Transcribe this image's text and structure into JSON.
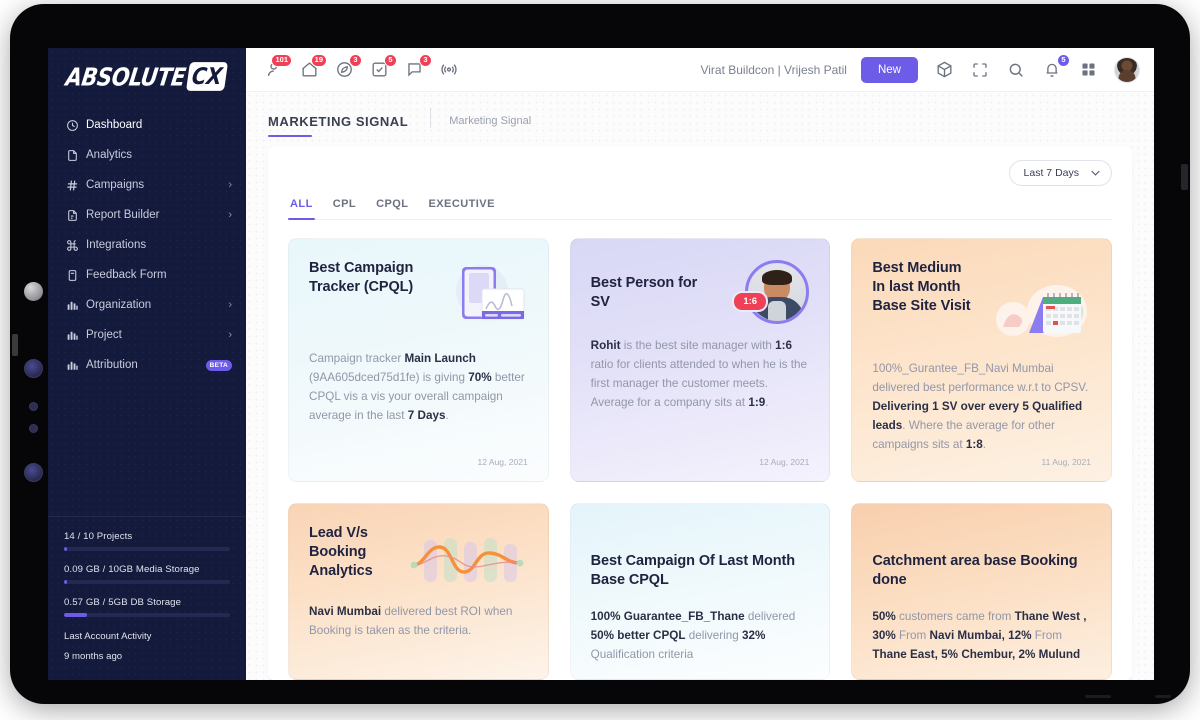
{
  "brand": {
    "name": "ABSOLUTE",
    "suffix": "CX",
    "accent": "#6c5ce7",
    "sidebar_bg": "#141a3c"
  },
  "sidebar": {
    "items": [
      {
        "label": "Dashboard",
        "icon": "clock-icon",
        "chevron": "",
        "badge": ""
      },
      {
        "label": "Analytics",
        "icon": "document-icon",
        "chevron": "",
        "badge": ""
      },
      {
        "label": "Campaigns",
        "icon": "hash-icon",
        "chevron": "›",
        "badge": ""
      },
      {
        "label": "Report Builder",
        "icon": "report-icon",
        "chevron": "›",
        "badge": ""
      },
      {
        "label": "Integrations",
        "icon": "command-icon",
        "chevron": "",
        "badge": ""
      },
      {
        "label": "Feedback Form",
        "icon": "form-icon",
        "chevron": "",
        "badge": ""
      },
      {
        "label": "Organization",
        "icon": "bar-chart-icon",
        "chevron": "›",
        "badge": ""
      },
      {
        "label": "Project",
        "icon": "bar-chart-icon",
        "chevron": "›",
        "badge": ""
      },
      {
        "label": "Attribution",
        "icon": "bar-chart-icon",
        "chevron": "",
        "badge": "BETA"
      }
    ],
    "stats": [
      {
        "label": "14 / 10 Projects",
        "pct": 2
      },
      {
        "label": "0.09 GB / 10GB Media Storage",
        "pct": 2
      },
      {
        "label": "0.57 GB / 5GB DB Storage",
        "pct": 14
      }
    ],
    "activity_title": "Last Account Activity",
    "activity_value": "9 months ago"
  },
  "topbar": {
    "icons": [
      {
        "name": "user-icon",
        "badge": "101"
      },
      {
        "name": "home-icon",
        "badge": "19"
      },
      {
        "name": "compass-icon",
        "badge": "3"
      },
      {
        "name": "task-icon",
        "badge": "5"
      },
      {
        "name": "chat-icon",
        "badge": "3"
      },
      {
        "name": "broadcast-icon",
        "badge": ""
      }
    ],
    "user": "Virat Buildcon | Vrijesh Patil",
    "new_label": "New",
    "right_icons": [
      {
        "name": "box-icon",
        "badge": ""
      },
      {
        "name": "fullscreen-icon",
        "badge": ""
      },
      {
        "name": "search-icon",
        "badge": ""
      },
      {
        "name": "bell-icon",
        "badge": "5"
      },
      {
        "name": "grid-icon",
        "badge": ""
      }
    ]
  },
  "page": {
    "title": "MARKETING SIGNAL",
    "breadcrumb": "Marketing Signal",
    "date_filter": "Last 7 Days",
    "date_filter_caret": "∨",
    "tabs": [
      {
        "label": "ALL",
        "active": true
      },
      {
        "label": "CPL",
        "active": false
      },
      {
        "label": "CPQL",
        "active": false
      },
      {
        "label": "EXECUTIVE",
        "active": false
      }
    ]
  },
  "cards": [
    {
      "title": "Best Campaign Tracker (CPQL)",
      "theme": "g-mint",
      "illustration": "phone-chart-illustration",
      "date": "12 Aug, 2021",
      "body": [
        {
          "t": "Campaign tracker ",
          "b": false
        },
        {
          "t": "Main Launch",
          "b": true
        },
        {
          "t": " (9AA605dced75d1fe) is giving ",
          "b": false
        },
        {
          "t": "70%",
          "b": true
        },
        {
          "t": " better CPQL vis a vis your overall campaign average in the last ",
          "b": false
        },
        {
          "t": "7 Days",
          "b": true
        },
        {
          "t": ".",
          "b": false
        }
      ]
    },
    {
      "title": "Best Person for SV",
      "theme": "g-violet",
      "illustration": "person-avatar-illustration",
      "ratio_badge": "1:6",
      "date": "12 Aug, 2021",
      "body": [
        {
          "t": "Rohit",
          "b": true
        },
        {
          "t": " is the best site manager with ",
          "b": false
        },
        {
          "t": "1:6",
          "b": true
        },
        {
          "t": " ratio for clients attended to when he is the first manager the customer meets. Average for a company sits at ",
          "b": false
        },
        {
          "t": "1:9",
          "b": true
        },
        {
          "t": ".",
          "b": false
        }
      ]
    },
    {
      "title": "Best Medium In last Month Base Site Visit",
      "theme": "g-peach",
      "illustration": "calendar-illustration",
      "date": "11 Aug, 2021",
      "body": [
        {
          "t": "100%_Gurantee_FB_Navi Mumbai delivered best performance w.r.t to CPSV. ",
          "b": false
        },
        {
          "t": "Delivering 1 SV over every 5 Qualified leads",
          "b": true
        },
        {
          "t": ". Where the average for other campaigns sits at ",
          "b": false
        },
        {
          "t": "1:8",
          "b": true
        },
        {
          "t": ".",
          "b": false
        }
      ]
    },
    {
      "title": "Lead V/s Booking Analytics",
      "theme": "g-peach2",
      "illustration": "wave-bars-illustration",
      "date": "",
      "body": [
        {
          "t": "Navi Mumbai",
          "b": true
        },
        {
          "t": " delivered best ROI when Booking is taken as the criteria.",
          "b": false
        }
      ]
    },
    {
      "title": "Best Campaign Of Last Month Base CPQL",
      "theme": "g-mint2",
      "illustration": "",
      "date": "",
      "body": [
        {
          "t": "100% Guarantee_FB_Thane",
          "b": true
        },
        {
          "t": " delivered ",
          "b": false
        },
        {
          "t": "50% better CPQL",
          "b": true
        },
        {
          "t": " delivering ",
          "b": false
        },
        {
          "t": "32%",
          "b": true
        },
        {
          "t": " Qualification criteria",
          "b": false
        }
      ]
    },
    {
      "title": "Catchment area base Booking done",
      "theme": "g-peach3",
      "illustration": "",
      "date": "",
      "body": [
        {
          "t": "50%",
          "b": true
        },
        {
          "t": " customers came from ",
          "b": false
        },
        {
          "t": "Thane West , 30%",
          "b": true
        },
        {
          "t": " From ",
          "b": false
        },
        {
          "t": "Navi Mumbai, 12%",
          "b": true
        },
        {
          "t": " From ",
          "b": false
        },
        {
          "t": "Thane East, 5% Chembur, 2% Mulund",
          "b": true
        }
      ]
    }
  ]
}
